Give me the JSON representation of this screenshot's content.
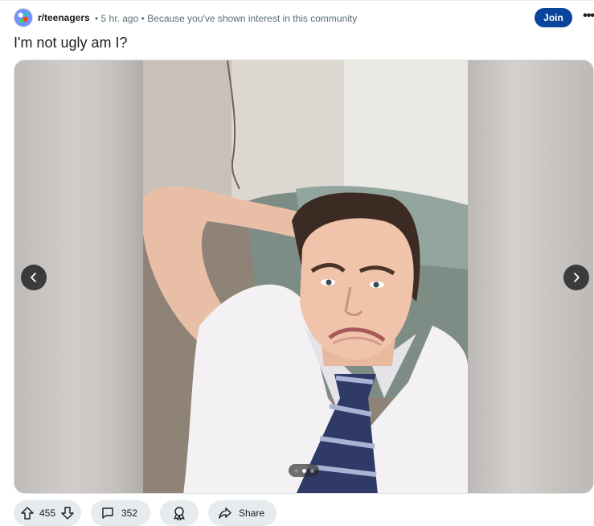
{
  "post": {
    "subreddit": "r/teenagers",
    "time_ago": "5 hr. ago",
    "reason": "Because you've shown interest in this community",
    "join_label": "Join",
    "more_label": "•••",
    "title": "I'm not ugly am I?"
  },
  "gallery": {
    "current_index": 2,
    "total": 3
  },
  "actions": {
    "vote_count": "455",
    "comment_count": "352",
    "share_label": "Share"
  },
  "colors": {
    "join_button": "#0a449b",
    "action_pill": "#e5ebee",
    "meta_text": "#576f76",
    "carousel_button": "#3b3b3b"
  }
}
